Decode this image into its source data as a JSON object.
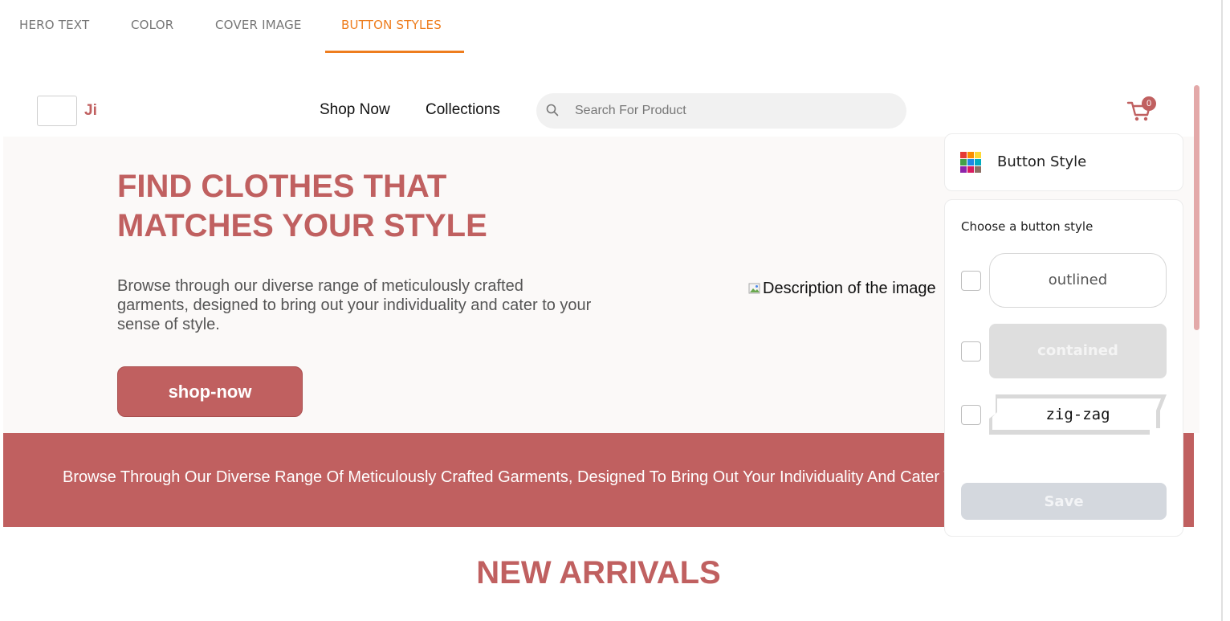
{
  "tabs": [
    {
      "label": "HERO TEXT"
    },
    {
      "label": "COLOR"
    },
    {
      "label": "COVER IMAGE"
    },
    {
      "label": "BUTTON STYLES",
      "active": true
    }
  ],
  "colors": {
    "accent": "#ee7d1e",
    "brand": "#c06060",
    "hero_bg": "#fbf9f8"
  },
  "site": {
    "logo_text": "Ji",
    "nav": [
      {
        "label": "Shop Now"
      },
      {
        "label": "Collections"
      }
    ],
    "search": {
      "placeholder": "Search For Product",
      "value": "",
      "icon": "search-icon"
    },
    "cart": {
      "icon": "cart-icon",
      "count": "0"
    }
  },
  "hero": {
    "title_line1": "FIND CLOTHES THAT",
    "title_line2": "MATCHES YOUR STYLE",
    "description": "Browse through our diverse range of meticulously crafted garments, designed to bring out your individuality and cater to your sense of style.",
    "button_label": "shop-now",
    "image_alt": "Description of the image"
  },
  "banner": {
    "text": "Browse Through Our Diverse Range Of Meticulously Crafted Garments, Designed To Bring Out Your Individuality And Cater To Your Sense Of Style."
  },
  "arrivals_title": "NEW ARRIVALS",
  "panel": {
    "title": "Button Style",
    "icon": "palette-icon",
    "choose_label": "Choose a button style",
    "options": [
      {
        "label": "outlined",
        "checked": false
      },
      {
        "label": "contained",
        "checked": false
      },
      {
        "label": "zig-zag",
        "checked": false
      }
    ],
    "save_label": "Save"
  }
}
